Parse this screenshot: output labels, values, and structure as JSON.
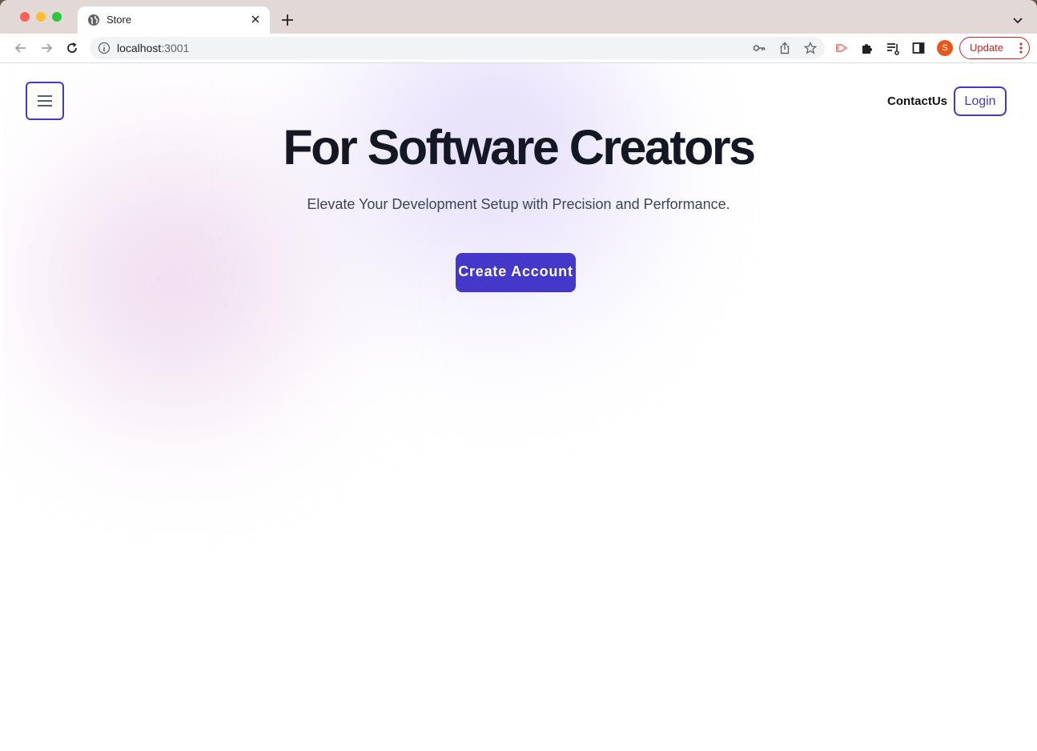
{
  "browser": {
    "tab": {
      "title": "Store"
    },
    "address": {
      "host": "localhost",
      "port": ":3001"
    },
    "update_label": "Update",
    "avatar_letter": "S"
  },
  "page": {
    "nav": {
      "contact_label": "ContactUs",
      "login_label": "Login"
    },
    "hero": {
      "title": "For Software Creators",
      "subtitle": "Elevate Your Development Setup with Precision and Performance.",
      "cta_label": "Create Account"
    }
  },
  "colors": {
    "accent": "#4338ca",
    "title": "#141824",
    "update_red": "#c5221f"
  }
}
